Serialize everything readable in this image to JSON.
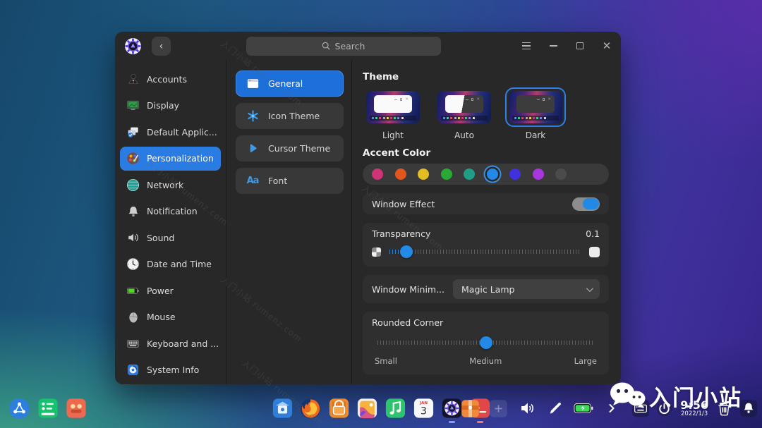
{
  "window": {
    "titlebar": {
      "search_placeholder": "Search"
    },
    "sidebar": {
      "items": [
        {
          "label": "Accounts",
          "icon": "person-icon",
          "selected": false
        },
        {
          "label": "Display",
          "icon": "display-icon",
          "selected": false
        },
        {
          "label": "Default Applic...",
          "icon": "default-apps-icon",
          "selected": false
        },
        {
          "label": "Personalization",
          "icon": "palette-icon",
          "selected": true
        },
        {
          "label": "Network",
          "icon": "globe-icon",
          "selected": false
        },
        {
          "label": "Notification",
          "icon": "bell-icon",
          "selected": false
        },
        {
          "label": "Sound",
          "icon": "speaker-icon",
          "selected": false
        },
        {
          "label": "Date and Time",
          "icon": "clock-icon",
          "selected": false
        },
        {
          "label": "Power",
          "icon": "battery-icon",
          "selected": false
        },
        {
          "label": "Mouse",
          "icon": "mouse-icon",
          "selected": false
        },
        {
          "label": "Keyboard and ...",
          "icon": "keyboard-icon",
          "selected": false
        },
        {
          "label": "System Info",
          "icon": "system-info-icon",
          "selected": false
        }
      ]
    },
    "tabs": [
      {
        "label": "General",
        "icon": "window-icon",
        "selected": true
      },
      {
        "label": "Icon Theme",
        "icon": "flower-icon",
        "selected": false
      },
      {
        "label": "Cursor Theme",
        "icon": "cursor-icon",
        "selected": false
      },
      {
        "label": "Font",
        "icon": "font-icon",
        "selected": false
      }
    ],
    "content": {
      "theme": {
        "heading": "Theme",
        "options": [
          {
            "label": "Light",
            "variant": "light",
            "selected": false
          },
          {
            "label": "Auto",
            "variant": "auto",
            "selected": false
          },
          {
            "label": "Dark",
            "variant": "dark",
            "selected": true
          }
        ]
      },
      "accent": {
        "heading": "Accent Color",
        "selected_index": 5,
        "colors": [
          "#cf3476",
          "#e3571e",
          "#e3bd23",
          "#2aaa35",
          "#1f9e85",
          "#2289e6",
          "#4030dd",
          "#a935dd",
          "#4b4b4b"
        ]
      },
      "window_effect": {
        "label": "Window Effect",
        "enabled": true
      },
      "transparency": {
        "label": "Transparency",
        "value": "0.1",
        "percent": 9
      },
      "minimize_effect": {
        "label": "Window Minim...",
        "value": "Magic Lamp"
      },
      "rounded_corner": {
        "label": "Rounded Corner",
        "percent": 50,
        "marks": [
          "Small",
          "Medium",
          "Large"
        ]
      }
    }
  },
  "dock": {
    "left": [
      {
        "name": "launcher",
        "icon": "launcher-icon"
      },
      {
        "name": "tasks",
        "icon": "tasks-icon"
      },
      {
        "name": "game",
        "icon": "orange-app-icon"
      }
    ],
    "apps": [
      {
        "name": "files",
        "icon": "files-icon"
      },
      {
        "name": "firefox",
        "icon": "firefox-icon"
      },
      {
        "name": "app-store",
        "icon": "appstore-icon"
      },
      {
        "name": "photos",
        "icon": "photos-icon"
      },
      {
        "name": "music",
        "icon": "music-icon"
      },
      {
        "name": "calendar",
        "icon": "calendar-icon",
        "badge": "3"
      },
      {
        "name": "settings",
        "icon": "settings-gear-icon",
        "running": true
      },
      {
        "name": "terminal",
        "icon": "terminal-icon",
        "running": true
      }
    ],
    "right": [
      {
        "name": "package",
        "icon": "package-icon"
      },
      {
        "name": "screenshot",
        "icon": "dim-app-icon"
      },
      {
        "name": "volume",
        "icon": "volume-icon"
      },
      {
        "name": "annotate",
        "icon": "pen-icon"
      },
      {
        "name": "battery",
        "icon": "battery-status-icon"
      },
      {
        "name": "expand",
        "icon": "chevron-right-icon"
      }
    ],
    "tray": {
      "before_clock": [
        {
          "name": "keyboard",
          "icon": "keyboard-tray-icon"
        },
        {
          "name": "power",
          "icon": "power-icon"
        }
      ],
      "time": "9:56",
      "date": "2022/1/3",
      "after_clock": [
        {
          "name": "trash",
          "icon": "trash-icon"
        },
        {
          "name": "notifications",
          "icon": "bell-tray-icon"
        }
      ]
    }
  },
  "watermark": {
    "brand": "入门小站",
    "diagonal": "入门小站 rumenz.com"
  }
}
